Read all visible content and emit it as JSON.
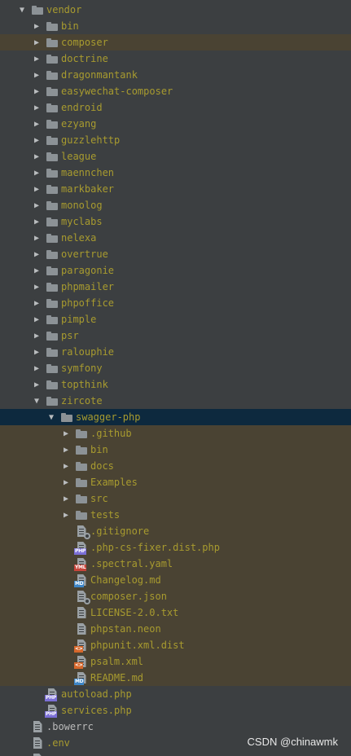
{
  "tree": [
    {
      "label": "vendor",
      "type": "folder",
      "depth": 0,
      "expanded": true
    },
    {
      "label": "bin",
      "type": "folder",
      "depth": 1,
      "expanded": false
    },
    {
      "label": "composer",
      "type": "folder",
      "depth": 1,
      "expanded": false,
      "highlight": true
    },
    {
      "label": "doctrine",
      "type": "folder",
      "depth": 1,
      "expanded": false
    },
    {
      "label": "dragonmantank",
      "type": "folder",
      "depth": 1,
      "expanded": false
    },
    {
      "label": "easywechat-composer",
      "type": "folder",
      "depth": 1,
      "expanded": false
    },
    {
      "label": "endroid",
      "type": "folder",
      "depth": 1,
      "expanded": false
    },
    {
      "label": "ezyang",
      "type": "folder",
      "depth": 1,
      "expanded": false
    },
    {
      "label": "guzzlehttp",
      "type": "folder",
      "depth": 1,
      "expanded": false
    },
    {
      "label": "league",
      "type": "folder",
      "depth": 1,
      "expanded": false
    },
    {
      "label": "maennchen",
      "type": "folder",
      "depth": 1,
      "expanded": false
    },
    {
      "label": "markbaker",
      "type": "folder",
      "depth": 1,
      "expanded": false
    },
    {
      "label": "monolog",
      "type": "folder",
      "depth": 1,
      "expanded": false
    },
    {
      "label": "myclabs",
      "type": "folder",
      "depth": 1,
      "expanded": false
    },
    {
      "label": "nelexa",
      "type": "folder",
      "depth": 1,
      "expanded": false
    },
    {
      "label": "overtrue",
      "type": "folder",
      "depth": 1,
      "expanded": false
    },
    {
      "label": "paragonie",
      "type": "folder",
      "depth": 1,
      "expanded": false
    },
    {
      "label": "phpmailer",
      "type": "folder",
      "depth": 1,
      "expanded": false
    },
    {
      "label": "phpoffice",
      "type": "folder",
      "depth": 1,
      "expanded": false
    },
    {
      "label": "pimple",
      "type": "folder",
      "depth": 1,
      "expanded": false
    },
    {
      "label": "psr",
      "type": "folder",
      "depth": 1,
      "expanded": false
    },
    {
      "label": "ralouphie",
      "type": "folder",
      "depth": 1,
      "expanded": false
    },
    {
      "label": "symfony",
      "type": "folder",
      "depth": 1,
      "expanded": false
    },
    {
      "label": "topthink",
      "type": "folder",
      "depth": 1,
      "expanded": false
    },
    {
      "label": "zircote",
      "type": "folder",
      "depth": 1,
      "expanded": true
    },
    {
      "label": "swagger-php",
      "type": "folder",
      "depth": 2,
      "expanded": true,
      "selected": true
    },
    {
      "label": ".github",
      "type": "folder",
      "depth": 3,
      "expanded": false,
      "highlight": true
    },
    {
      "label": "bin",
      "type": "folder",
      "depth": 3,
      "expanded": false,
      "highlight": true
    },
    {
      "label": "docs",
      "type": "folder",
      "depth": 3,
      "expanded": false,
      "highlight": true
    },
    {
      "label": "Examples",
      "type": "folder",
      "depth": 3,
      "expanded": false,
      "highlight": true
    },
    {
      "label": "src",
      "type": "folder",
      "depth": 3,
      "expanded": false,
      "highlight": true
    },
    {
      "label": "tests",
      "type": "folder",
      "depth": 3,
      "expanded": false,
      "highlight": true
    },
    {
      "label": ".gitignore",
      "type": "file",
      "icon": "gear-file-icon",
      "depth": 3,
      "highlight": true
    },
    {
      "label": ".php-cs-fixer.dist.php",
      "type": "file",
      "icon": "php-file-icon",
      "badge": "PHP",
      "depth": 3,
      "highlight": true
    },
    {
      "label": ".spectral.yaml",
      "type": "file",
      "icon": "yaml-file-icon",
      "badge": "YML",
      "depth": 3,
      "highlight": true
    },
    {
      "label": "Changelog.md",
      "type": "file",
      "icon": "markdown-file-icon",
      "badge": "MD",
      "depth": 3,
      "highlight": true
    },
    {
      "label": "composer.json",
      "type": "file",
      "icon": "gear-file-icon",
      "depth": 3,
      "highlight": true
    },
    {
      "label": "LICENSE-2.0.txt",
      "type": "file",
      "icon": "text-file-icon",
      "depth": 3,
      "highlight": true
    },
    {
      "label": "phpstan.neon",
      "type": "file",
      "icon": "text-file-icon",
      "depth": 3,
      "highlight": true
    },
    {
      "label": "phpunit.xml.dist",
      "type": "file",
      "icon": "xml-file-icon",
      "badge": "<>",
      "depth": 3,
      "highlight": true
    },
    {
      "label": "psalm.xml",
      "type": "file",
      "icon": "xml-file-icon",
      "badge": "<>",
      "depth": 3,
      "highlight": true
    },
    {
      "label": "README.md",
      "type": "file",
      "icon": "markdown-file-icon",
      "badge": "MD",
      "depth": 3,
      "highlight": true
    },
    {
      "label": "autoload.php",
      "type": "file",
      "icon": "php-file-icon",
      "badge": "PHP",
      "depth": 1
    },
    {
      "label": "services.php",
      "type": "file",
      "icon": "php-file-icon",
      "badge": "PHP",
      "depth": 1
    },
    {
      "label": ".bowerrc",
      "type": "file",
      "icon": "text-file-icon",
      "depth": 0,
      "plain": true
    },
    {
      "label": ".env",
      "type": "file",
      "icon": "text-file-icon",
      "depth": 0
    },
    {
      "label": "",
      "type": "file",
      "icon": "text-file-icon",
      "depth": 0,
      "plain": true
    }
  ],
  "watermark": "CSDN @chinawmk",
  "colors": {
    "background": "#3c3f41",
    "highlight_row": "#4a4333",
    "selected_row": "#0d293e",
    "label_olive": "#a89b2f",
    "label_plain": "#bbbbbb"
  }
}
